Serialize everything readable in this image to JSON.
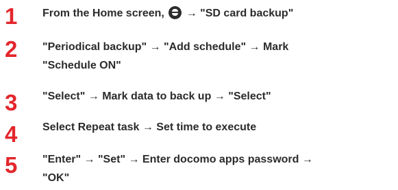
{
  "steps": [
    {
      "number": "1",
      "prefix": "From the Home screen, ",
      "icon": "home-key-icon",
      "after_icon": " → \"SD card backup\""
    },
    {
      "number": "2",
      "line1": "\"Periodical backup\" → \"Add schedule\" → Mark",
      "line2": "\"Schedule ON\""
    },
    {
      "number": "3",
      "line1": "\"Select\" → Mark data to back up → \"Select\""
    },
    {
      "number": "4",
      "line1": "Select Repeat task → Set time to execute"
    },
    {
      "number": "5",
      "line1": "\"Enter\" → \"Set\" → Enter docomo apps password →",
      "line2": "\"OK\""
    }
  ],
  "colors": {
    "step_number": "#e3262c",
    "text": "#2b2b2b",
    "background": "#ffffff"
  }
}
